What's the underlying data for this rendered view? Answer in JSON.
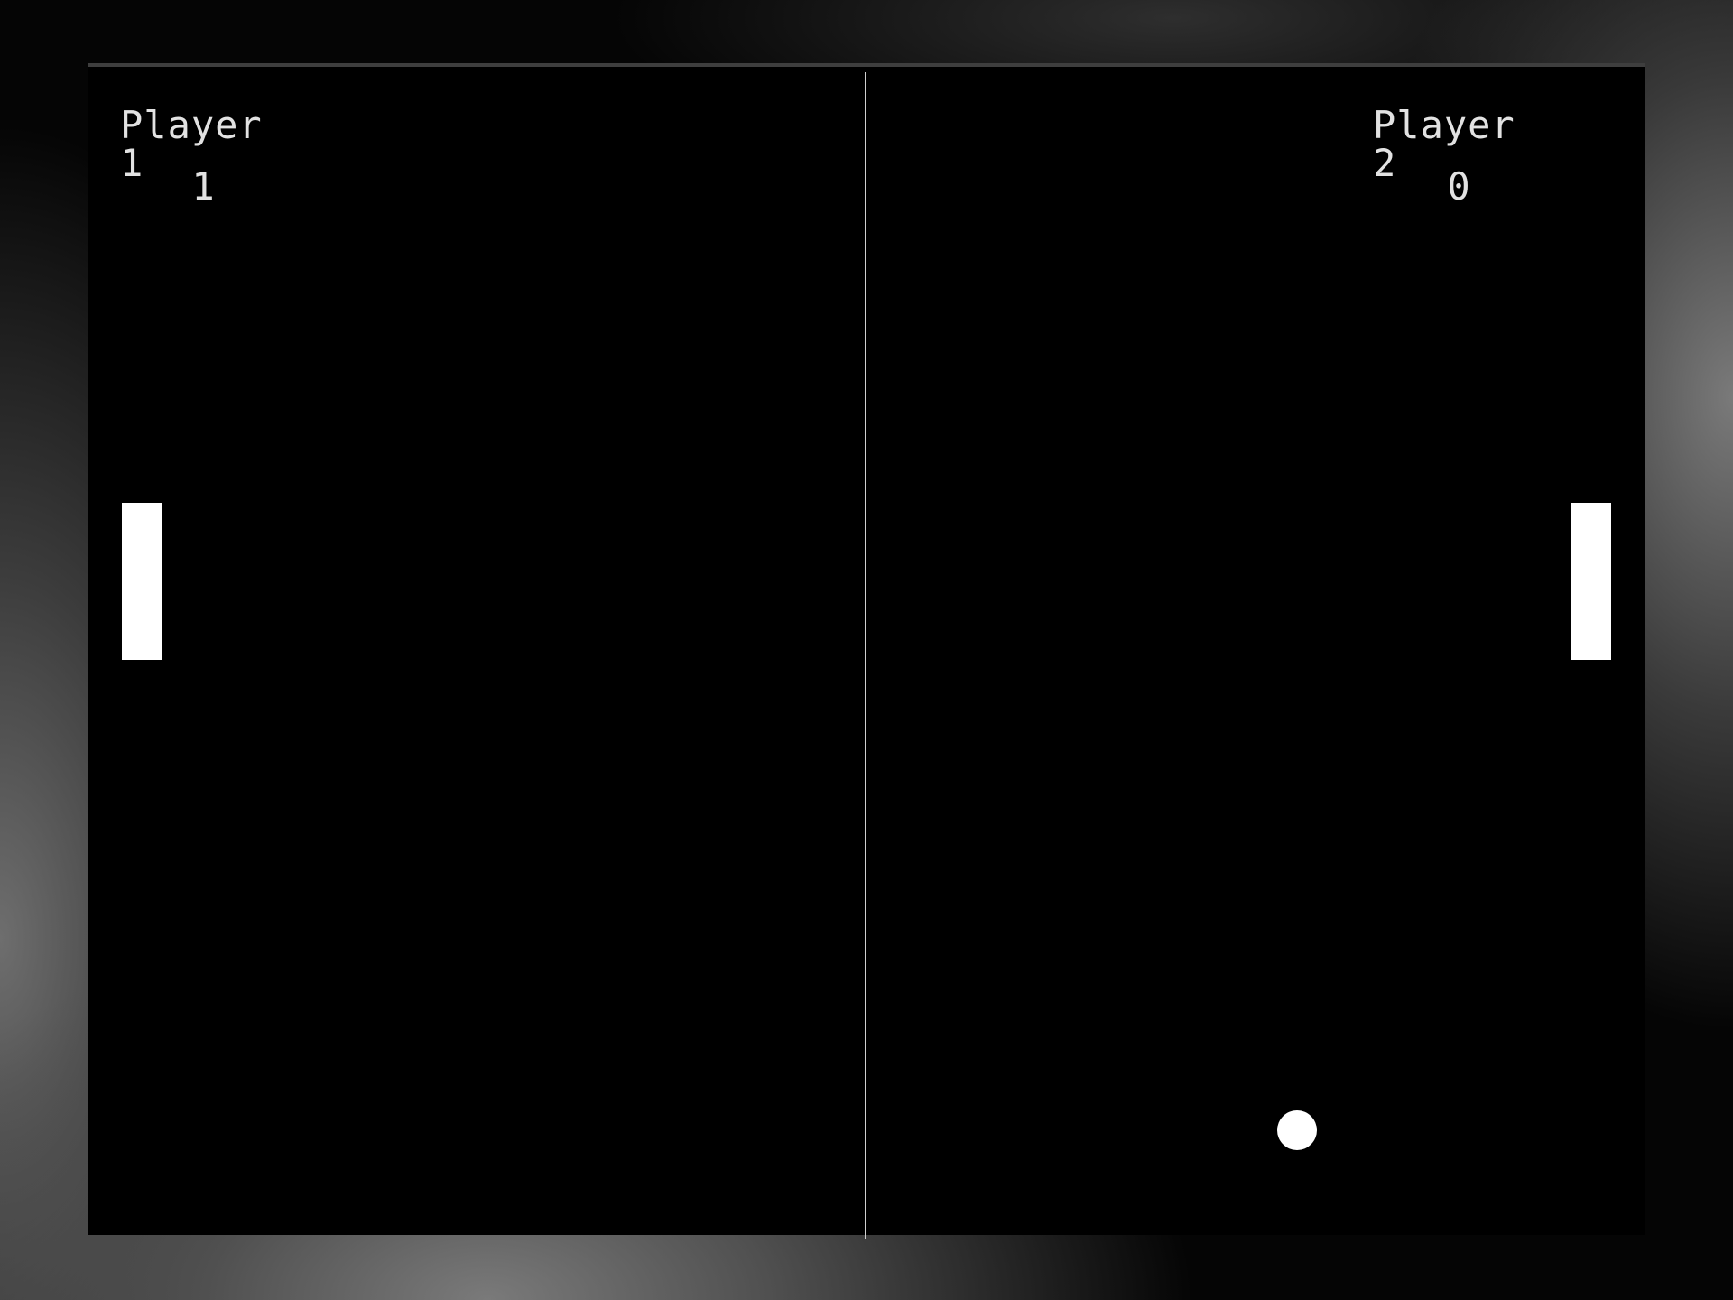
{
  "players": [
    {
      "label": "Player 1",
      "score": "1"
    },
    {
      "label": "Player 2",
      "score": "0"
    }
  ],
  "colors": {
    "playfield": "#000000",
    "paddle": "#ffffff",
    "ball": "#ffffff",
    "text": "#e2e2e2",
    "center_line": "#cfcfcf"
  }
}
